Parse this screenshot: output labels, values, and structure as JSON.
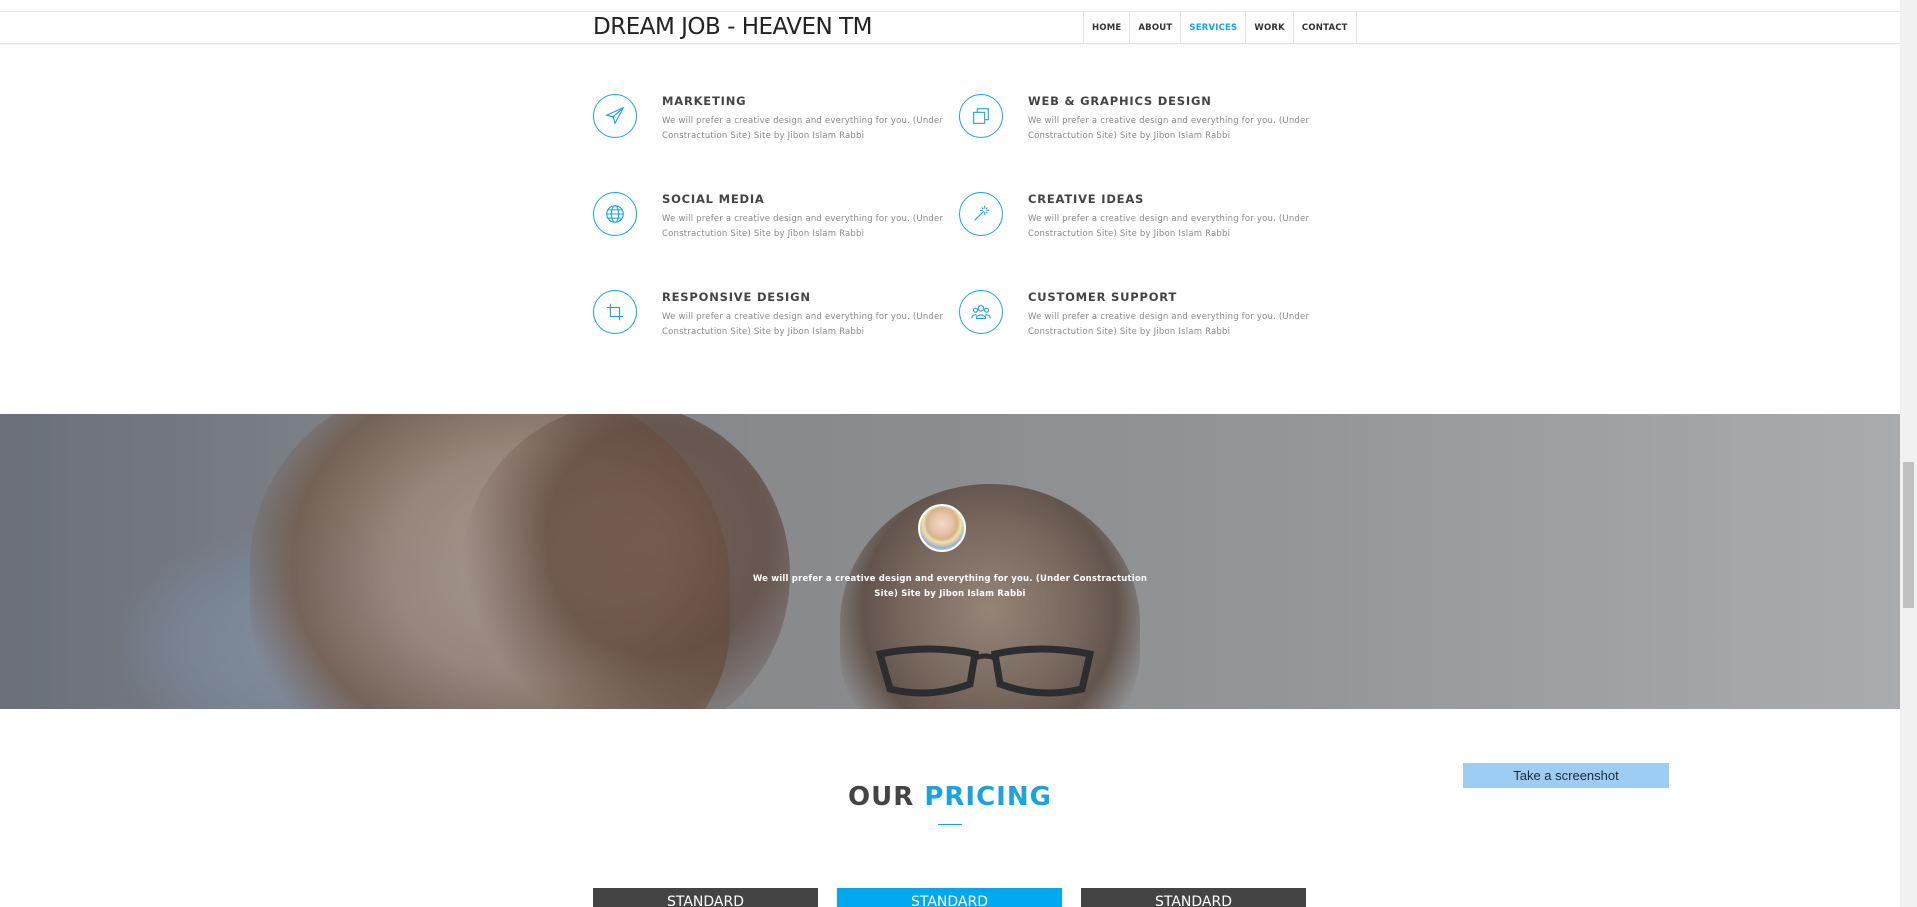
{
  "brand": "DREAM JOB - HEAVEN TM",
  "nav": [
    {
      "label": "HOME",
      "active": false
    },
    {
      "label": "ABOUT",
      "active": false
    },
    {
      "label": "SERVICES",
      "active": true
    },
    {
      "label": "WORK",
      "active": false
    },
    {
      "label": "CONTACT",
      "active": false
    }
  ],
  "services": [
    {
      "title": "MARKETING",
      "icon": "paper-plane-icon",
      "desc": "We will prefer a creative design and everything for you. (Under Constractution Site) Site by Jibon Islam Rabbi"
    },
    {
      "title": "WEB & GRAPHICS DESIGN",
      "icon": "layers-icon",
      "desc": "We will prefer a creative design and everything for you. (Under Constractution Site) Site by Jibon Islam Rabbi"
    },
    {
      "title": "SOCIAL MEDIA",
      "icon": "globe-icon",
      "desc": "We will prefer a creative design and everything for you. (Under Constractution Site) Site by Jibon Islam Rabbi"
    },
    {
      "title": "CREATIVE IDEAS",
      "icon": "magic-wand-icon",
      "desc": "We will prefer a creative design and everything for you. (Under Constractution Site) Site by Jibon Islam Rabbi"
    },
    {
      "title": "RESPONSIVE DESIGN",
      "icon": "crop-icon",
      "desc": "We will prefer a creative design and everything for you. (Under Constractution Site) Site by Jibon Islam Rabbi"
    },
    {
      "title": "CUSTOMER SUPPORT",
      "icon": "users-icon",
      "desc": "We will prefer a creative design and everything for you. (Under Constractution Site) Site by Jibon Islam Rabbi"
    }
  ],
  "testimonial": {
    "quote": "We will prefer a creative design and everything for you. (Under Constractution Site) Site by Jibon Islam Rabbi"
  },
  "pricing": {
    "title_main": "OUR",
    "title_accent": "PRICING",
    "plans": [
      "STANDARD",
      "STANDARD",
      "STANDARD"
    ]
  },
  "screenshot_button": "Take a screenshot",
  "colors": {
    "accent": "#1aa3e0",
    "plan_dark": "#444444",
    "plan_blue": "#00a8f0"
  }
}
